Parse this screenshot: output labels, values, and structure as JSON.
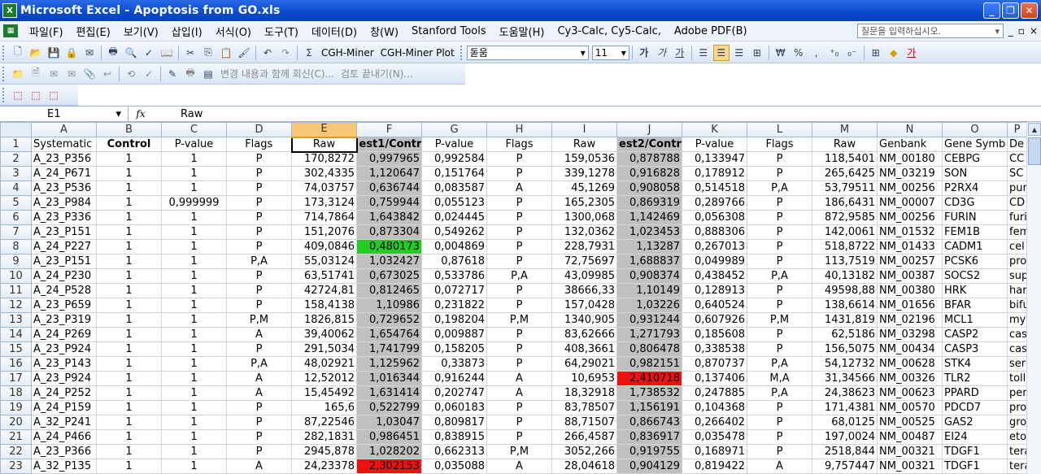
{
  "window": {
    "title": "Microsoft Excel - Apoptosis from GO.xls",
    "app_icon": "excel-icon"
  },
  "menubar": {
    "items": [
      "파일(F)",
      "편집(E)",
      "보기(V)",
      "삽입(I)",
      "서식(O)",
      "도구(T)",
      "데이터(D)",
      "창(W)",
      "Stanford Tools",
      "도움말(H)",
      "Cy3-Calc, Cy5-Calc,",
      "Adobe PDF(B)"
    ],
    "help_placeholder": "질문을 입력하십시오.",
    "help_arrow": "▾",
    "doc_controls": [
      "_",
      "▫",
      "×"
    ]
  },
  "toolbar": {
    "cgh1": "CGH-Miner",
    "cgh2": "CGH-Miner Plot",
    "font_name": "돋움",
    "font_size": "11",
    "bold": "가",
    "italic": "가",
    "underline": "가",
    "currency": "₩",
    "percent": "%",
    "comma": ",",
    "review_text": "변경 내용과 함께 회신(C)...",
    "end_review": "검토 끝내기(N)..."
  },
  "formula": {
    "namebox": "E1",
    "fx": "fx",
    "value": "Raw"
  },
  "sheet": {
    "columns": [
      "A",
      "B",
      "C",
      "D",
      "E",
      "F",
      "G",
      "H",
      "I",
      "J",
      "K",
      "L",
      "M",
      "N",
      "O",
      "P"
    ],
    "selected_column": "E",
    "header_row": [
      "Systematic",
      "Control",
      "P-value",
      "Flags",
      "Raw",
      "est1/Contr",
      "P-value",
      "Flags",
      "Raw",
      "est2/Contr",
      "P-value",
      "Flags",
      "Raw",
      "Genbank",
      "Gene Symb",
      "De"
    ],
    "rows": [
      {
        "n": "2",
        "a": "A_23_P356",
        "b": "1",
        "c": "1",
        "d": "P",
        "e": "170,8272",
        "f": "0,997965",
        "g": "0,992584",
        "h": "P",
        "i": "159,0536",
        "j": "0,878788",
        "k": "0,133947",
        "l": "P",
        "m": "118,5401",
        "nn": "NM_00180",
        "o": "CEBPG",
        "p": "CC"
      },
      {
        "n": "3",
        "a": "A_24_P671",
        "b": "1",
        "c": "1",
        "d": "P",
        "e": "302,4335",
        "f": "1,120647",
        "g": "0,151764",
        "h": "P",
        "i": "339,1278",
        "j": "0,916828",
        "k": "0,178912",
        "l": "P",
        "m": "265,6425",
        "nn": "NM_03219",
        "o": "SON",
        "p": "SC"
      },
      {
        "n": "4",
        "a": "A_23_P536",
        "b": "1",
        "c": "1",
        "d": "P",
        "e": "74,03757",
        "f": "0,636744",
        "g": "0,083587",
        "h": "A",
        "i": "45,1269",
        "j": "0,908058",
        "k": "0,514518",
        "l": "P,A",
        "m": "53,79511",
        "nn": "NM_00256",
        "o": "P2RX4",
        "p": "pur"
      },
      {
        "n": "5",
        "a": "A_23_P984",
        "b": "1",
        "c": "0,999999",
        "d": "P",
        "e": "173,3124",
        "f": "0,759944",
        "g": "0,055123",
        "h": "P",
        "i": "165,2305",
        "j": "0,869319",
        "k": "0,289766",
        "l": "P",
        "m": "186,6431",
        "nn": "NM_00007",
        "o": "CD3G",
        "p": "CD"
      },
      {
        "n": "6",
        "a": "A_23_P336",
        "b": "1",
        "c": "1",
        "d": "P",
        "e": "714,7864",
        "f": "1,643842",
        "g": "0,024445",
        "h": "P",
        "i": "1300,068",
        "j": "1,142469",
        "k": "0,056308",
        "l": "P",
        "m": "872,9585",
        "nn": "NM_00256",
        "o": "FURIN",
        "p": "furi"
      },
      {
        "n": "7",
        "a": "A_23_P151",
        "b": "1",
        "c": "1",
        "d": "P",
        "e": "151,2076",
        "f": "0,873304",
        "g": "0,549262",
        "h": "P",
        "i": "132,0362",
        "j": "1,023453",
        "k": "0,888306",
        "l": "P",
        "m": "142,0061",
        "nn": "NM_01532",
        "o": "FEM1B",
        "p": "fem"
      },
      {
        "n": "8",
        "a": "A_24_P227",
        "b": "1",
        "c": "1",
        "d": "P",
        "e": "409,0846",
        "f": "0,480173",
        "g": "0,004869",
        "h": "P",
        "i": "228,7931",
        "j": "1,13287",
        "k": "0,267013",
        "l": "P",
        "m": "518,8722",
        "nn": "NM_01433",
        "o": "CADM1",
        "p": "cel"
      },
      {
        "n": "9",
        "a": "A_23_P151",
        "b": "1",
        "c": "1",
        "d": "P,A",
        "e": "55,03124",
        "f": "1,032427",
        "g": "0,87618",
        "h": "P",
        "i": "72,75697",
        "j": "1,688837",
        "k": "0,049989",
        "l": "P",
        "m": "113,7519",
        "nn": "NM_00257",
        "o": "PCSK6",
        "p": "pro"
      },
      {
        "n": "10",
        "a": "A_24_P230",
        "b": "1",
        "c": "1",
        "d": "P",
        "e": "63,51741",
        "f": "0,673025",
        "g": "0,533786",
        "h": "P,A",
        "i": "43,09985",
        "j": "0,908374",
        "k": "0,438452",
        "l": "P,A",
        "m": "40,13182",
        "nn": "NM_00387",
        "o": "SOCS2",
        "p": "sup"
      },
      {
        "n": "11",
        "a": "A_24_P528",
        "b": "1",
        "c": "1",
        "d": "P",
        "e": "42724,81",
        "f": "0,812465",
        "g": "0,072717",
        "h": "P",
        "i": "38666,33",
        "j": "1,10149",
        "k": "0,128913",
        "l": "P",
        "m": "49598,88",
        "nn": "NM_00380",
        "o": "HRK",
        "p": "har"
      },
      {
        "n": "12",
        "a": "A_23_P659",
        "b": "1",
        "c": "1",
        "d": "P",
        "e": "158,4138",
        "f": "1,10986",
        "g": "0,231822",
        "h": "P",
        "i": "157,0428",
        "j": "1,03226",
        "k": "0,640524",
        "l": "P",
        "m": "138,6614",
        "nn": "NM_01656",
        "o": "BFAR",
        "p": "bifu"
      },
      {
        "n": "13",
        "a": "A_23_P319",
        "b": "1",
        "c": "1",
        "d": "P,M",
        "e": "1826,815",
        "f": "0,729652",
        "g": "0,198204",
        "h": "P,M",
        "i": "1340,905",
        "j": "0,931244",
        "k": "0,607926",
        "l": "P,M",
        "m": "1431,819",
        "nn": "NM_02196",
        "o": "MCL1",
        "p": "my"
      },
      {
        "n": "14",
        "a": "A_24_P269",
        "b": "1",
        "c": "1",
        "d": "A",
        "e": "39,40062",
        "f": "1,654764",
        "g": "0,009887",
        "h": "P",
        "i": "83,62666",
        "j": "1,271793",
        "k": "0,185608",
        "l": "P",
        "m": "62,5186",
        "nn": "NM_03298",
        "o": "CASP2",
        "p": "cas"
      },
      {
        "n": "15",
        "a": "A_23_P924",
        "b": "1",
        "c": "1",
        "d": "P",
        "e": "291,5034",
        "f": "1,741799",
        "g": "0,158205",
        "h": "P",
        "i": "408,3661",
        "j": "0,806478",
        "k": "0,338538",
        "l": "P",
        "m": "156,5075",
        "nn": "NM_00434",
        "o": "CASP3",
        "p": "cas"
      },
      {
        "n": "16",
        "a": "A_23_P143",
        "b": "1",
        "c": "1",
        "d": "P,A",
        "e": "48,02921",
        "f": "1,125962",
        "g": "0,33873",
        "h": "P",
        "i": "64,29021",
        "j": "0,982151",
        "k": "0,870737",
        "l": "P,A",
        "m": "54,12732",
        "nn": "NM_00628",
        "o": "STK4",
        "p": "ser"
      },
      {
        "n": "17",
        "a": "A_23_P924",
        "b": "1",
        "c": "1",
        "d": "A",
        "e": "12,52012",
        "f": "1,016344",
        "g": "0,916244",
        "h": "A",
        "i": "10,6953",
        "j": "2,410718",
        "k": "0,137406",
        "l": "M,A",
        "m": "31,34566",
        "nn": "NM_00326",
        "o": "TLR2",
        "p": "toll"
      },
      {
        "n": "18",
        "a": "A_24_P252",
        "b": "1",
        "c": "1",
        "d": "A",
        "e": "15,45492",
        "f": "1,631414",
        "g": "0,202747",
        "h": "A",
        "i": "18,32918",
        "j": "1,738532",
        "k": "0,247885",
        "l": "P,A",
        "m": "24,38623",
        "nn": "NM_00623",
        "o": "PPARD",
        "p": "per"
      },
      {
        "n": "19",
        "a": "A_24_P159",
        "b": "1",
        "c": "1",
        "d": "P",
        "e": "165,6",
        "f": "0,522799",
        "g": "0,060183",
        "h": "P",
        "i": "83,78507",
        "j": "1,156191",
        "k": "0,104368",
        "l": "P",
        "m": "171,4381",
        "nn": "NM_00570",
        "o": "PDCD7",
        "p": "pro"
      },
      {
        "n": "20",
        "a": "A_32_P241",
        "b": "1",
        "c": "1",
        "d": "P",
        "e": "87,22546",
        "f": "1,03047",
        "g": "0,809817",
        "h": "P",
        "i": "88,71507",
        "j": "0,866743",
        "k": "0,266402",
        "l": "P",
        "m": "68,0125",
        "nn": "NM_00525",
        "o": "GAS2",
        "p": "gro"
      },
      {
        "n": "21",
        "a": "A_24_P466",
        "b": "1",
        "c": "1",
        "d": "P",
        "e": "282,1831",
        "f": "0,986451",
        "g": "0,838915",
        "h": "P",
        "i": "266,4587",
        "j": "0,836917",
        "k": "0,035478",
        "l": "P",
        "m": "197,0024",
        "nn": "NM_00487",
        "o": "EI24",
        "p": "eto"
      },
      {
        "n": "22",
        "a": "A_23_P366",
        "b": "1",
        "c": "1",
        "d": "P",
        "e": "2945,878",
        "f": "1,028202",
        "g": "0,662313",
        "h": "P,M",
        "i": "3052,266",
        "j": "0,919755",
        "k": "0,168971",
        "l": "P",
        "m": "2518,844",
        "nn": "NM_00321",
        "o": "TDGF1",
        "p": "tera"
      },
      {
        "n": "23",
        "a": "A_32_P135",
        "b": "1",
        "c": "1",
        "d": "A",
        "e": "24,23378",
        "f": "2,302153",
        "g": "0,035088",
        "h": "A",
        "i": "28,04618",
        "j": "0,904129",
        "k": "0,819422",
        "l": "A",
        "m": "9,757447",
        "nn": "NM_00321",
        "o": "TDGF1",
        "p": "tera"
      }
    ],
    "highlights": {
      "green": [
        "8:f"
      ],
      "red": [
        "17:j",
        "23:f"
      ]
    }
  }
}
